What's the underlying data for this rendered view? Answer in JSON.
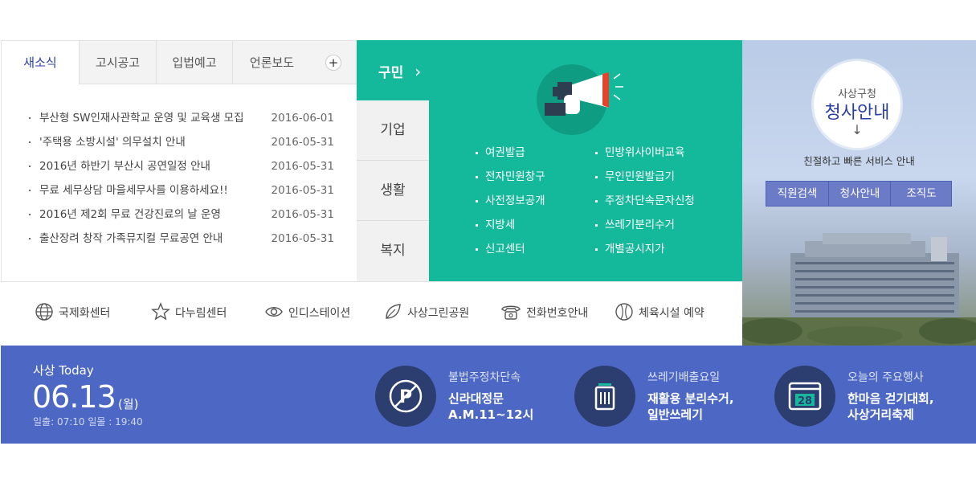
{
  "news": {
    "tabs": [
      "새소식",
      "고시공고",
      "입법예고",
      "언론보도"
    ],
    "more_label": "+",
    "items": [
      {
        "title": "부산형 SW인재사관학교 운영 및 교육생 모집",
        "date": "2016-06-01"
      },
      {
        "title": "'주택용 소방시설' 의무설치 안내",
        "date": "2016-05-31"
      },
      {
        "title": "2016년 하반기 부산시 공연일정 안내",
        "date": "2016-05-31"
      },
      {
        "title": "무료 세무상담 마을세무사를 이용하세요!!",
        "date": "2016-05-31"
      },
      {
        "title": "2016년 제2회 무료 건강진료의 날 운영",
        "date": "2016-05-31"
      },
      {
        "title": "출산장려 창작 가족뮤지컬 무료공연 안내",
        "date": "2016-05-31"
      }
    ]
  },
  "categories": {
    "active": "구민",
    "active_arrow": "›",
    "others": [
      "기업",
      "생활",
      "복지"
    ]
  },
  "services": {
    "left": [
      "여권발급",
      "전자민원창구",
      "사전정보공개",
      "지방세",
      "신고센터"
    ],
    "right": [
      "민방위사이버교육",
      "무인민원발급기",
      "주정차단속문자신청",
      "쓰레기분리수거",
      "개별공시지가"
    ]
  },
  "building": {
    "small": "사상구청",
    "big": "청사안내",
    "arrow": "↓",
    "desc": "친절하고 빠른 서비스 안내",
    "buttons": [
      "직원검색",
      "청사안내",
      "조직도"
    ]
  },
  "quick_links": [
    {
      "label": "국제화센터",
      "icon": "globe-icon"
    },
    {
      "label": "다누림센터",
      "icon": "star-icon"
    },
    {
      "label": "인디스테이션",
      "icon": "eye-icon"
    },
    {
      "label": "사상그린공원",
      "icon": "leaf-icon"
    },
    {
      "label": "전화번호안내",
      "icon": "phone-icon"
    },
    {
      "label": "체육시설 예약",
      "icon": "ball-icon"
    }
  ],
  "today": {
    "label": "사상 Today",
    "date": "06.13",
    "day": "(월)",
    "sun": "일출: 07:10 일몰 : 19:40",
    "items": [
      {
        "title": "불법주정차단속",
        "line1": "신라대정문",
        "line2": "A.M.11~12시",
        "icon": "no-parking-icon"
      },
      {
        "title": "쓰레기배출요일",
        "line1": "재활용 분리수거,",
        "line2": "일반쓰레기",
        "icon": "trash-can-icon"
      },
      {
        "title": "오늘의 주요행사",
        "line1": "한마음 걷기대회,",
        "line2": "사상거리축제",
        "icon": "calendar-icon",
        "calendar_day": "28"
      }
    ]
  },
  "colors": {
    "green": "#14b89a",
    "blue": "#4d68c4",
    "navy_circle": "#2c3d70",
    "active_tab_text": "#2a3fa4"
  }
}
